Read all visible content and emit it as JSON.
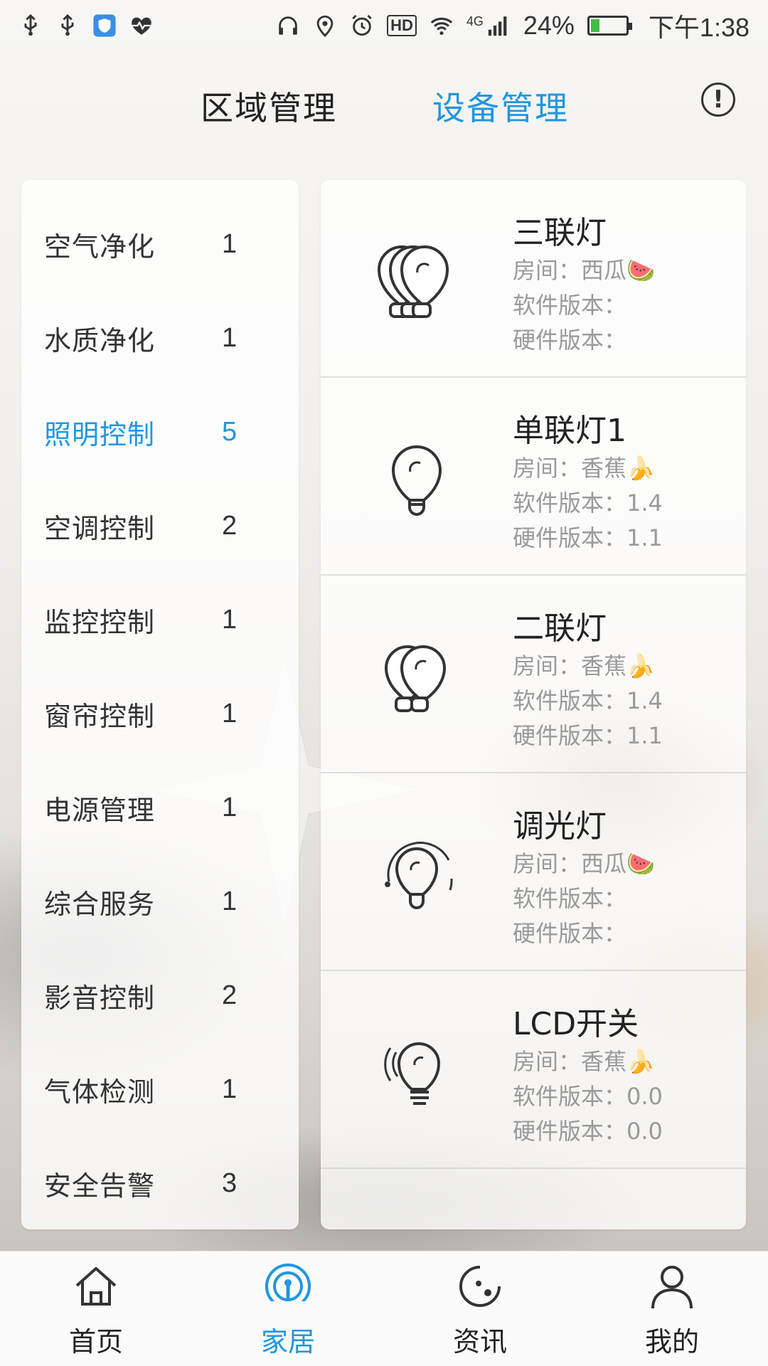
{
  "status_bar": {
    "time": "下午1:38",
    "battery": "24%",
    "network": "4G",
    "hd": "HD"
  },
  "header": {
    "tabs": [
      {
        "label": "区域管理",
        "active": false
      },
      {
        "label": "设备管理",
        "active": true
      }
    ],
    "info_icon": "info-icon",
    "info_glyph": "!"
  },
  "colors": {
    "accent": "#2196e0",
    "text": "#222222",
    "secondary_text": "#9a9a9a"
  },
  "categories": [
    {
      "label": "空气净化",
      "count": "1"
    },
    {
      "label": "水质净化",
      "count": "1"
    },
    {
      "label": "照明控制",
      "count": "5",
      "active": true
    },
    {
      "label": "空调控制",
      "count": "2"
    },
    {
      "label": "监控控制",
      "count": "1"
    },
    {
      "label": "窗帘控制",
      "count": "1"
    },
    {
      "label": "电源管理",
      "count": "1"
    },
    {
      "label": "综合服务",
      "count": "1"
    },
    {
      "label": "影音控制",
      "count": "2"
    },
    {
      "label": "气体检测",
      "count": "1"
    },
    {
      "label": "安全告警",
      "count": "3"
    }
  ],
  "devices": [
    {
      "name": "三联灯",
      "icon": "triple-bulb-icon",
      "room": "房间：西瓜🍉",
      "software": "软件版本：",
      "hardware": "硬件版本："
    },
    {
      "name": "单联灯1",
      "icon": "single-bulb-icon",
      "room": "房间：香蕉🍌",
      "software": "软件版本：1.4",
      "hardware": "硬件版本：1.1"
    },
    {
      "name": "二联灯",
      "icon": "double-bulb-icon",
      "room": "房间：香蕉🍌",
      "software": "软件版本：1.4",
      "hardware": "硬件版本：1.1"
    },
    {
      "name": "调光灯",
      "icon": "dimmer-bulb-icon",
      "room": "房间：西瓜🍉",
      "software": "软件版本：",
      "hardware": "硬件版本："
    },
    {
      "name": "LCD开关",
      "icon": "lcd-switch-bulb-icon",
      "room": "房间：香蕉🍌",
      "software": "软件版本：0.0",
      "hardware": "硬件版本：0.0"
    }
  ],
  "bottom_nav": [
    {
      "label": "首页",
      "icon": "home-icon"
    },
    {
      "label": "家居",
      "icon": "antenna-icon",
      "active": true
    },
    {
      "label": "资讯",
      "icon": "news-icon"
    },
    {
      "label": "我的",
      "icon": "profile-icon"
    }
  ]
}
